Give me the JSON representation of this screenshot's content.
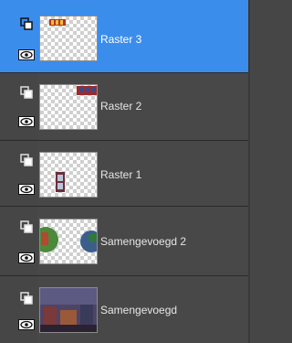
{
  "layers_panel": {
    "layers": [
      {
        "name": "Raster 3",
        "selected": true,
        "visibility_icon": "eye-icon",
        "type_icon": "layer-link-icon"
      },
      {
        "name": "Raster 2",
        "selected": false,
        "visibility_icon": "eye-icon",
        "type_icon": "layer-link-icon"
      },
      {
        "name": "Raster 1",
        "selected": false,
        "visibility_icon": "eye-icon",
        "type_icon": "layer-link-icon"
      },
      {
        "name": "Samengevoegd 2",
        "selected": false,
        "visibility_icon": "eye-icon",
        "type_icon": "layer-link-icon"
      },
      {
        "name": "Samengevoegd",
        "selected": false,
        "visibility_icon": "eye-icon",
        "type_icon": "layer-link-icon"
      }
    ],
    "colors": {
      "panel_bg": "#464646",
      "selected_bg": "#3b8dec",
      "text": "#e6e6e6",
      "selected_text": "#ffffff"
    }
  }
}
